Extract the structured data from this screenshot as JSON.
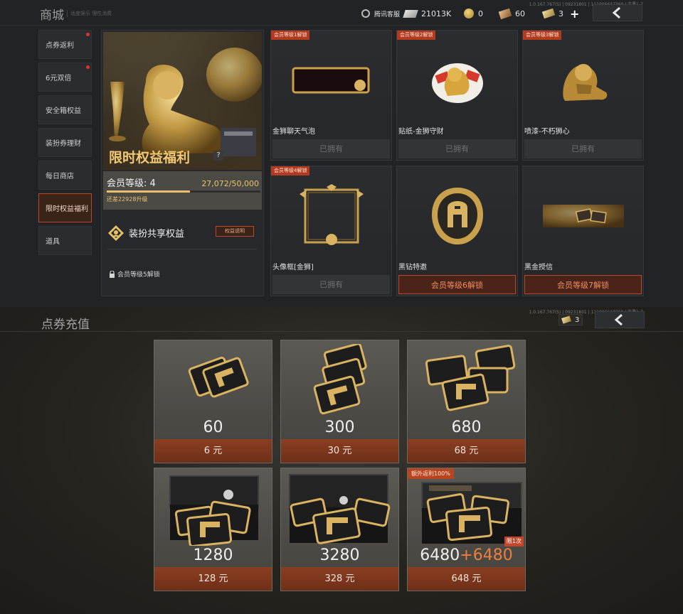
{
  "shop": {
    "title": "商城",
    "subtitle": "适度娱乐 理性消费",
    "version": "1.0.167.767(S) | 09231801 | 111006647369 | 监黑1-7",
    "currencies": {
      "customer_service": "腾讯客服",
      "silver": "21013K",
      "gold": "0",
      "tickets": "60",
      "vouchers": "3"
    },
    "sidebar": [
      {
        "label": "点券返利",
        "dot": true
      },
      {
        "label": "6元双倍",
        "dot": true
      },
      {
        "label": "安全箱权益",
        "dot": false
      },
      {
        "label": "装扮券理财",
        "dot": false
      },
      {
        "label": "每日商店",
        "dot": false
      },
      {
        "label": "限时权益福利",
        "dot": false,
        "active": true
      },
      {
        "label": "道具",
        "dot": false
      }
    ],
    "promo": {
      "title": "限时权益福利",
      "help": "?",
      "level_label": "会员等级: 4",
      "progress_text": "27,072/50,000",
      "progress_fraction": 0.54,
      "hint": "还差22928升级",
      "share_title": "装扮共享权益",
      "share_button": "权益说明",
      "lock_text": "会员等级5解锁"
    },
    "rewards": [
      {
        "tag": "会员等级1解锁",
        "name": "金狮聊天气泡",
        "status": "已拥有",
        "locked": false
      },
      {
        "tag": "会员等级2解锁",
        "name": "贴纸-金狮守财",
        "status": "已拥有",
        "locked": false
      },
      {
        "tag": "会员等级3解锁",
        "name": "喷漆-不朽狮心",
        "status": "已拥有",
        "locked": false
      },
      {
        "tag": "会员等级4解锁",
        "name": "头像框[金狮]",
        "status": "已拥有",
        "locked": false
      },
      {
        "tag": "",
        "name": "黑钻特邀",
        "status": "会员等级6解锁",
        "locked": true
      },
      {
        "tag": "",
        "name": "黑金授信",
        "status": "会员等级7解锁",
        "locked": true
      }
    ]
  },
  "recharge": {
    "title": "点券充值",
    "version": "1.0.167.767(S) | 09231801 | 111006647369 | 监黑1-7",
    "voucher_count": "3",
    "packs": [
      {
        "amount": "60",
        "bonus": "",
        "price": "6 元",
        "extra": "",
        "limit": ""
      },
      {
        "amount": "300",
        "bonus": "",
        "price": "30 元",
        "extra": "",
        "limit": ""
      },
      {
        "amount": "680",
        "bonus": "",
        "price": "68 元",
        "extra": "",
        "limit": ""
      },
      {
        "amount": "1280",
        "bonus": "",
        "price": "128 元",
        "extra": "",
        "limit": ""
      },
      {
        "amount": "3280",
        "bonus": "",
        "price": "328 元",
        "extra": "",
        "limit": ""
      },
      {
        "amount": "6480",
        "bonus": "+6480",
        "price": "648 元",
        "extra": "额外返利100%",
        "limit": "限1次"
      }
    ]
  },
  "colors": {
    "accent_red": "#b23a1e",
    "gold": "#e9c46b",
    "bonus_orange": "#ef7e3c"
  }
}
